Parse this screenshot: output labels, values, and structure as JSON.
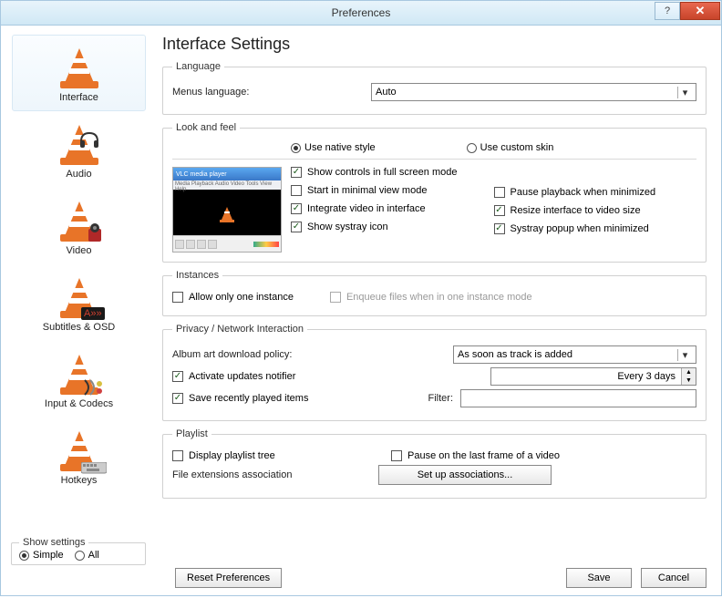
{
  "window": {
    "title": "Preferences"
  },
  "sidebar": {
    "items": [
      {
        "label": "Interface",
        "selected": true
      },
      {
        "label": "Audio"
      },
      {
        "label": "Video"
      },
      {
        "label": "Subtitles & OSD"
      },
      {
        "label": "Input & Codecs"
      },
      {
        "label": "Hotkeys"
      }
    ]
  },
  "show_settings": {
    "legend": "Show settings",
    "simple": "Simple",
    "all": "All",
    "selected": "simple"
  },
  "page": {
    "title": "Interface Settings",
    "language": {
      "legend": "Language",
      "menus_label": "Menus language:",
      "value": "Auto"
    },
    "look": {
      "legend": "Look and feel",
      "native": "Use native style",
      "custom": "Use custom skin",
      "preview_title": "VLC media player",
      "preview_menu": "Media  Playback  Audio  Video  Tools  View  Help",
      "show_controls": "Show controls in full screen mode",
      "start_minimal": "Start in minimal view mode",
      "integrate_video": "Integrate video in interface",
      "show_systray": "Show systray icon",
      "pause_minimized": "Pause playback when minimized",
      "resize_interface": "Resize interface to video size",
      "systray_popup": "Systray popup when minimized"
    },
    "instances": {
      "legend": "Instances",
      "allow_one": "Allow only one instance",
      "enqueue": "Enqueue files when in one instance mode"
    },
    "privacy": {
      "legend": "Privacy / Network Interaction",
      "album_art_label": "Album art download policy:",
      "album_art_value": "As soon as track is added",
      "activate_updates": "Activate updates notifier",
      "update_freq": "Every 3 days",
      "save_recent": "Save recently played items",
      "filter_label": "Filter:"
    },
    "playlist": {
      "legend": "Playlist",
      "display_tree": "Display playlist tree",
      "pause_last_frame": "Pause on the last frame of a video",
      "file_ext_label": "File extensions association",
      "setup_btn": "Set up associations..."
    }
  },
  "buttons": {
    "reset": "Reset Preferences",
    "save": "Save",
    "cancel": "Cancel"
  }
}
